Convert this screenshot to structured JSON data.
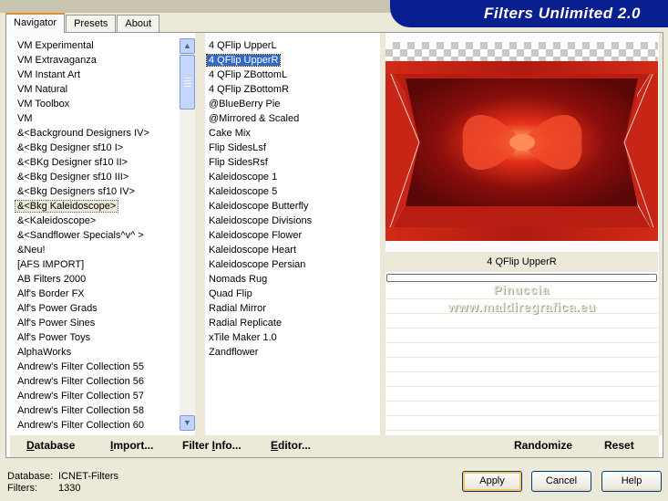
{
  "window": {
    "brand_title": "Filters Unlimited 2.0"
  },
  "tabs": [
    {
      "label": "Navigator",
      "active": true
    },
    {
      "label": "Presets",
      "active": false
    },
    {
      "label": "About",
      "active": false
    }
  ],
  "categories": {
    "items": [
      "VM Experimental",
      "VM Extravaganza",
      "VM Instant Art",
      "VM Natural",
      "VM Toolbox",
      "VM",
      "&<Background Designers IV>",
      "&<Bkg Designer sf10 I>",
      "&<BKg Designer sf10 II>",
      "&<Bkg Designer sf10 III>",
      "&<Bkg Designers sf10 IV>",
      "&<Bkg Kaleidoscope>",
      "&<Kaleidoscope>",
      "&<Sandflower Specials^v^ >",
      "&Neu!",
      "[AFS IMPORT]",
      "AB Filters 2000",
      "Alf's Border FX",
      "Alf's Power Grads",
      "Alf's Power Sines",
      "Alf's Power Toys",
      "AlphaWorks",
      "Andrew's Filter Collection 55",
      "Andrew's Filter Collection 56",
      "Andrew's Filter Collection 57",
      "Andrew's Filter Collection 58",
      "Andrew's Filter Collection 60"
    ],
    "selected_index": 11
  },
  "filters": {
    "items": [
      "4 QFlip UpperL",
      "4 QFlip UpperR",
      "4 QFlip ZBottomL",
      "4 QFlip ZBottomR",
      "@BlueBerry Pie",
      "@Mirrored & Scaled",
      "Cake Mix",
      "Flip SidesLsf",
      "Flip SidesRsf",
      "Kaleidoscope 1",
      "Kaleidoscope 5",
      "Kaleidoscope Butterfly",
      "Kaleidoscope Divisions",
      "Kaleidoscope Flower",
      "Kaleidoscope Heart",
      "Kaleidoscope Persian",
      "Nomads Rug",
      "Quad Flip",
      "Radial Mirror",
      "Radial Replicate",
      "xTile Maker 1.0",
      "Zandflower"
    ],
    "selected_index": 1
  },
  "preview": {
    "filter_name": "4 QFlip UpperR",
    "progress": 0
  },
  "watermark": {
    "line1": "Pinuccia",
    "line2": "www.maldiregrafica.eu"
  },
  "bottom_buttons": {
    "database": {
      "label": "Database",
      "mnemonic": "D",
      "rest": "atabase"
    },
    "import": {
      "label": "Import...",
      "mnemonic": "I",
      "rest": "mport..."
    },
    "filter_info": {
      "label": "Filter Info...",
      "pre": "Filter ",
      "mnemonic": "I",
      "rest": "nfo..."
    },
    "editor": {
      "label": "Editor...",
      "mnemonic": "E",
      "rest": "ditor..."
    },
    "randomize": "Randomize",
    "reset": "Reset"
  },
  "status": {
    "database_label": "Database:",
    "database_value": "ICNET-Filters",
    "filters_label": "Filters:",
    "filters_value": "1330"
  },
  "dialog_buttons": {
    "apply": "Apply",
    "cancel": "Cancel",
    "help": "Help"
  },
  "colors": {
    "accent": "#e68b2c",
    "selection": "#316ac5",
    "brand": "#0a1f8f"
  }
}
